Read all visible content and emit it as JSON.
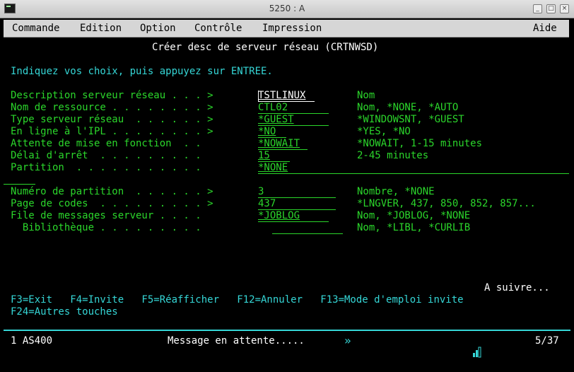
{
  "window": {
    "title": "5250 : A"
  },
  "menu": {
    "items": [
      "Commande",
      "Edition",
      "Option",
      "Contrôle",
      "Impression"
    ],
    "help": "Aide"
  },
  "screen": {
    "heading": "Créer desc de serveur réseau (CRTNWSD)",
    "instruction": "Indiquez vos choix, puis appuyez sur ENTREE.",
    "fields": [
      {
        "label": "Description serveur réseau . . . >",
        "value": "TSTLINUX",
        "hint": "Nom"
      },
      {
        "label": "Nom de ressource . . . . . . . . >",
        "value": "CTL02",
        "hint": "Nom, *NONE, *AUTO"
      },
      {
        "label": "Type serveur réseau  . . . . . . >",
        "value": "*GUEST",
        "hint": "*WINDOWSNT, *GUEST"
      },
      {
        "label": "En ligne à l'IPL . . . . . . . . >",
        "value": "*NO",
        "hint": "*YES, *NO"
      },
      {
        "label": "Attente de mise en fonction  . .",
        "value": "*NOWAIT",
        "hint": "*NOWAIT, 1-15 minutes"
      },
      {
        "label": "Délai d'arrêt  . . . . . . . . .",
        "value": "15",
        "hint": "2-45 minutes"
      },
      {
        "label": "Partition  . . . . . . . . . . .",
        "value": "*NONE",
        "hint": ""
      },
      {
        "label": "Numéro de partition  . . . . . . >",
        "value": "3",
        "hint": "Nombre, *NONE"
      },
      {
        "label": "Page de codes  . . . . . . . . . >",
        "value": "437",
        "hint": "*LNGVER, 437, 850, 852, 857..."
      },
      {
        "label": "File de messages serveur . . . .",
        "value": "*JOBLOG",
        "hint": "Nom, *JOBLOG, *NONE"
      },
      {
        "label": "  Bibliothèque . . . . . . . . .",
        "value": "",
        "hint": "Nom, *LIBL, *CURLIB"
      }
    ],
    "more": "A suivre...",
    "fkeys_line1": "F3=Exit   F4=Invite   F5=Réafficher   F12=Annuler   F13=Mode d'emploi invite",
    "fkeys_line2": "F24=Autres touches"
  },
  "status": {
    "session": "1 AS400",
    "message": "Message en attente.....",
    "arrow": "»",
    "position": "5/37"
  },
  "colors": {
    "field_green": "#2bd62b",
    "text_cyan": "#35d6d6",
    "input_white": "#ffffff"
  }
}
